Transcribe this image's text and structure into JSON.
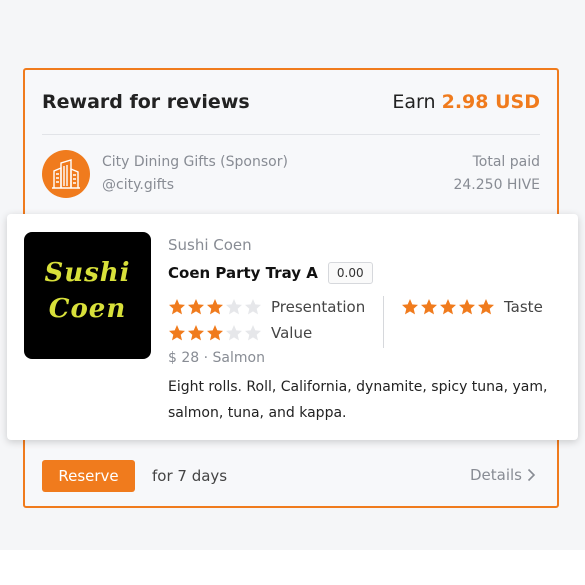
{
  "card": {
    "title": "Reward for reviews",
    "earn_label": "Earn",
    "earn_amount": "2.98 USD",
    "accent_color": "#f07b1d"
  },
  "sponsor": {
    "name": "City Dining Gifts (Sponsor)",
    "handle": "@city.gifts",
    "avatar_icon": "city-buildings-icon",
    "paid_label": "Total paid",
    "paid_value": "24.250 HIVE"
  },
  "item": {
    "logo_lines": [
      "Sushi",
      "Coen"
    ],
    "restaurant": "Sushi Coen",
    "name": "Coen Party Tray A",
    "score": "0.00",
    "ratings": [
      {
        "label": "Presentation",
        "stars": 3,
        "max": 5
      },
      {
        "label": "Value",
        "stars": 3,
        "max": 5
      },
      {
        "label": "Taste",
        "stars": 5,
        "max": 5
      }
    ],
    "price_line": "$ 28 · Salmon",
    "description": "Eight rolls. Roll, California, dynamite, spicy tuna, yam, salmon, tuna, and kappa."
  },
  "footer": {
    "reserve_label": "Reserve",
    "duration": "for 7 days",
    "details_label": "Details"
  }
}
